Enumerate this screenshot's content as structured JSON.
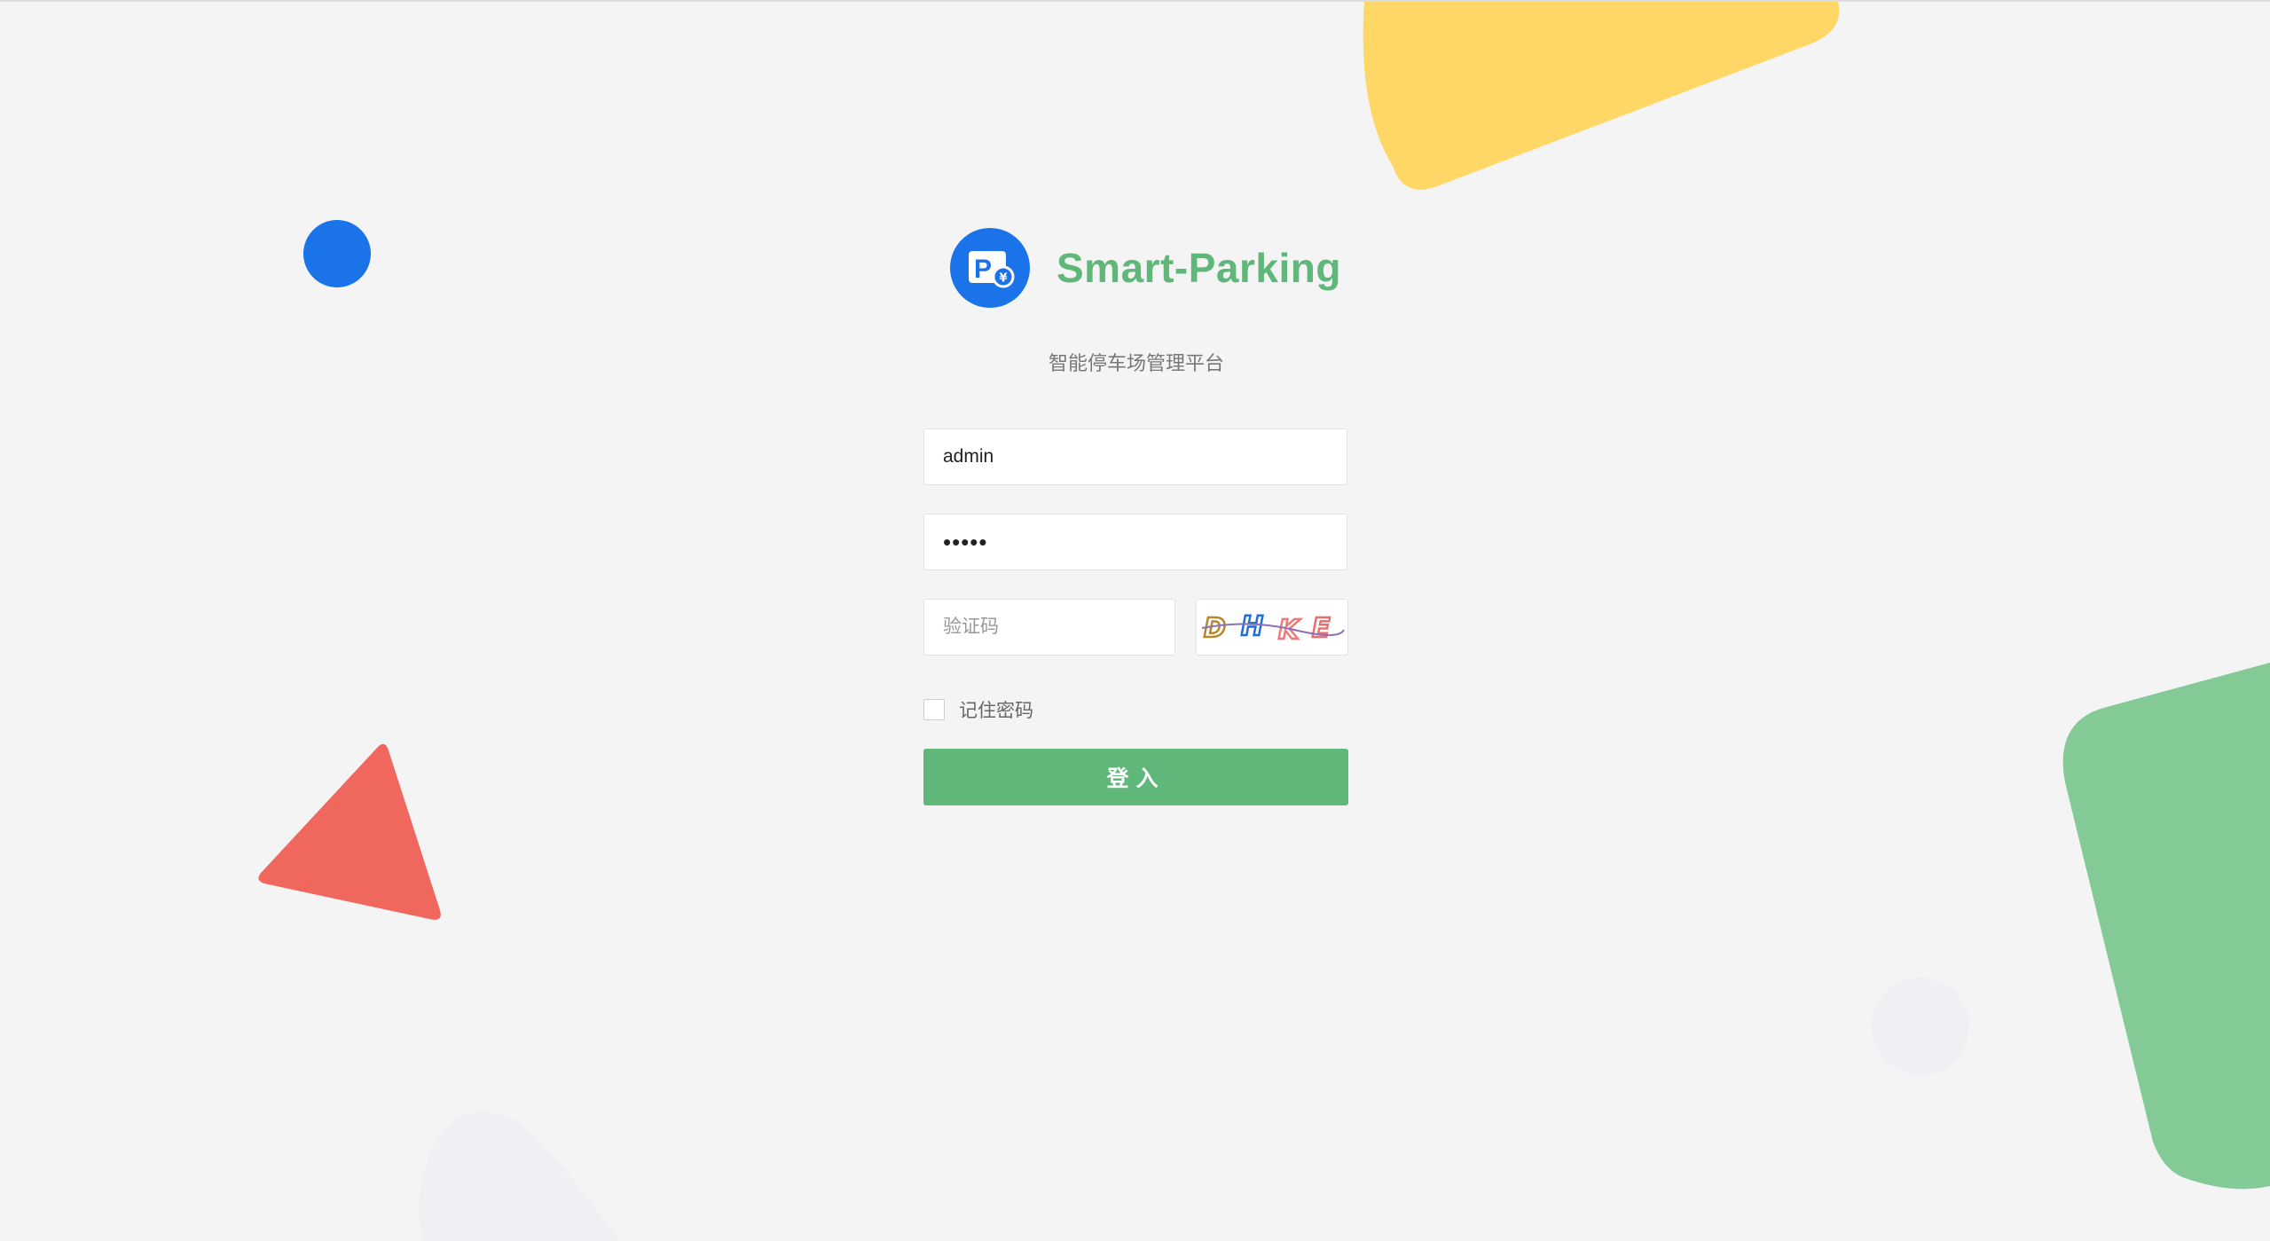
{
  "brand": {
    "title": "Smart-Parking",
    "subtitle": "智能停车场管理平台",
    "logo_icon": "parking-payment-icon",
    "logo_letter": "P",
    "logo_badge": "¥"
  },
  "form": {
    "username_value": "admin",
    "password_value": "•••••",
    "captcha_placeholder": "验证码",
    "captcha_text": "DHKE",
    "remember_label": "记住密码",
    "remember_checked": false,
    "login_label": "登入"
  },
  "colors": {
    "accent_green": "#5fb779",
    "brand_blue": "#1a73e8",
    "yellow": "#ffd766",
    "red": "#ef675d",
    "light_green": "#84ca96",
    "background": "#f4f4f4"
  }
}
